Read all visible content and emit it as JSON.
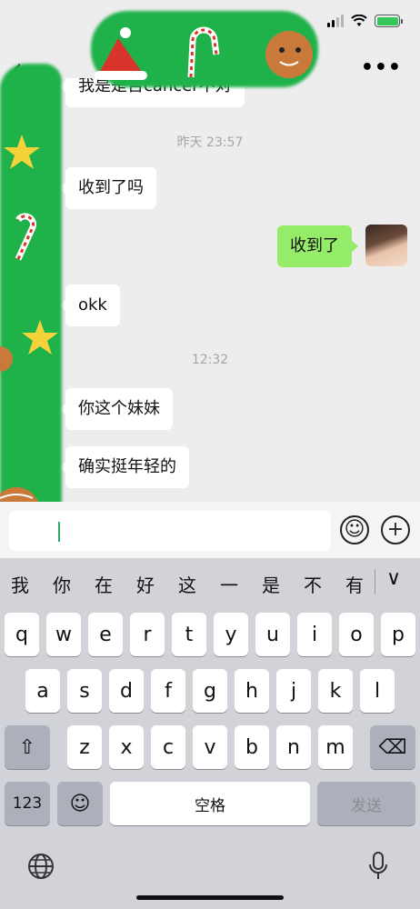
{
  "status_bar": {
    "icons": [
      "signal-icon",
      "wifi-icon",
      "battery-icon"
    ]
  },
  "nav": {
    "more_label": "•••"
  },
  "messages": [
    {
      "side": "left",
      "text": "我是是否cancer不对"
    },
    {
      "type": "time",
      "text": "昨天 23:57"
    },
    {
      "side": "left",
      "text": "收到了吗"
    },
    {
      "side": "right",
      "text": "收到了"
    },
    {
      "side": "left",
      "text": "okk"
    },
    {
      "type": "time",
      "text": "12:32"
    },
    {
      "side": "left",
      "text": "你这个妹妹"
    },
    {
      "side": "left",
      "text": "确实挺年轻的"
    }
  ],
  "input_bar": {
    "value": "",
    "emoji_icon": "☺",
    "plus_icon": "+"
  },
  "keyboard": {
    "candidates": [
      "我",
      "你",
      "在",
      "好",
      "这",
      "一",
      "是",
      "不",
      "有"
    ],
    "chevron": "∨",
    "row1": [
      "q",
      "w",
      "e",
      "r",
      "t",
      "y",
      "u",
      "i",
      "o",
      "p"
    ],
    "row2": [
      "a",
      "s",
      "d",
      "f",
      "g",
      "h",
      "j",
      "k",
      "l"
    ],
    "row3": [
      "z",
      "x",
      "c",
      "v",
      "b",
      "n",
      "m"
    ],
    "shift": "⇧",
    "delete": "⌫",
    "num_key": "123",
    "emoji_key": "☺",
    "space_label": "空格",
    "send_label": "发送",
    "globe_icon": "globe-icon",
    "mic_icon": "mic-icon"
  },
  "colors": {
    "self_bubble": "#95ec69",
    "other_bubble": "#ffffff",
    "chat_bg": "#ededed",
    "keyboard_bg": "#d1d3d9"
  }
}
